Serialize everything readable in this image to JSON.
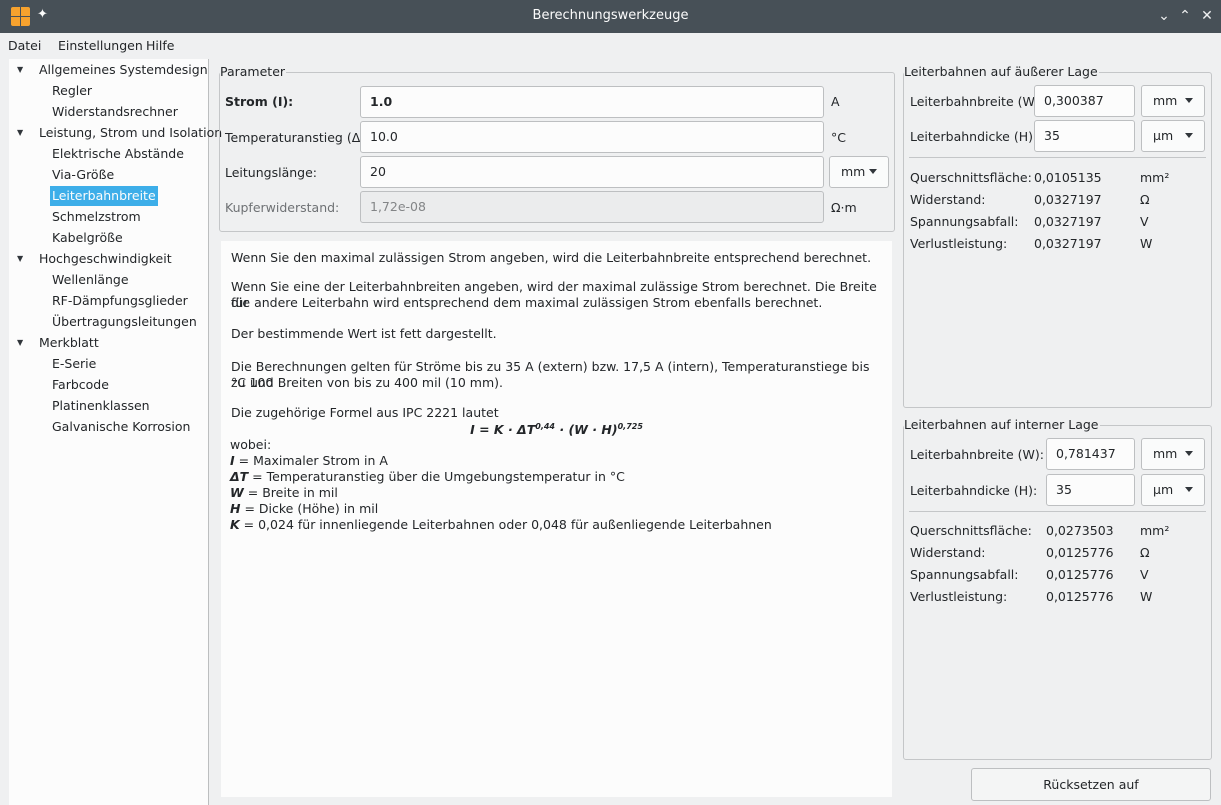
{
  "window": {
    "title": "Berechnungswerkzeuge",
    "controls": {
      "minimize": "⌄",
      "maximize": "⌃",
      "close": "✕"
    }
  },
  "menubar": [
    "Datei",
    "Einstellungen",
    "Hilfe"
  ],
  "sidebar": {
    "groups": [
      {
        "label": "Allgemeines Systemdesign",
        "items": [
          "Regler",
          "Widerstandsrechner"
        ]
      },
      {
        "label": "Leistung, Strom und Isolation",
        "items": [
          "Elektrische Abstände",
          "Via-Größe",
          "Leiterbahnbreite",
          "Schmelzstrom",
          "Kabelgröße"
        ]
      },
      {
        "label": "Hochgeschwindigkeit",
        "items": [
          "Wellenlänge",
          "RF-Dämpfungsglieder",
          "Übertragungsleitungen"
        ]
      },
      {
        "label": "Merkblatt",
        "items": [
          "E-Serie",
          "Farbcode",
          "Platinenklassen",
          "Galvanische Korrosion"
        ]
      }
    ],
    "selected": "Leiterbahnbreite"
  },
  "parameters": {
    "title": "Parameter",
    "current_label": "Strom (I):",
    "current_value": "1.0",
    "current_unit": "A",
    "temp_label": "Temperaturanstieg (ΔT):",
    "temp_value": "10.0",
    "temp_unit": "°C",
    "length_label": "Leitungslänge:",
    "length_value": "20",
    "length_unit": "mm",
    "resist_label": "Kupferwiderstand:",
    "resist_value": "1,72e-08",
    "resist_unit": "Ω·m"
  },
  "description": {
    "p1": "Wenn Sie den maximal zulässigen Strom angeben, wird die Leiterbahnbreite entsprechend berechnet.",
    "p2a": "Wenn Sie eine der Leiterbahnbreiten angeben, wird der maximal zulässige Strom berechnet. Die Breite für",
    "p2b": "die andere Leiterbahn wird entsprechend dem maximal zulässigen Strom ebenfalls berechnet.",
    "p3": "Der bestimmende Wert ist fett dargestellt.",
    "p4a": "Die Berechnungen gelten für Ströme bis zu 35 A (extern) bzw. 17,5 A (intern), Temperaturanstiege bis zu 100",
    "p4b": "°C und Breiten von bis zu 400 mil (10 mm).",
    "p5": "Die zugehörige Formel aus IPC 2221 lautet",
    "formula_main": "I = K · ΔT",
    "formula_exp1": "0,44",
    "formula_mid": " · (W · H)",
    "formula_exp2": "0,725",
    "wobei": "wobei:",
    "defs": [
      {
        "sym": "I",
        "text": " = Maximaler Strom in A"
      },
      {
        "sym": "ΔT",
        "text": " = Temperaturanstieg über die Umgebungstemperatur in °C"
      },
      {
        "sym": "W",
        "text": " = Breite in mil"
      },
      {
        "sym": "H",
        "text": " = Dicke (Höhe) in mil"
      },
      {
        "sym": "K",
        "text": " = 0,024 für innenliegende Leiterbahnen oder 0,048 für außenliegende Leiterbahnen"
      }
    ]
  },
  "external": {
    "title": "Leiterbahnen auf äußerer Lage",
    "width_label": "Leiterbahnbreite (W):",
    "width_value": "0,300387",
    "width_unit": "mm",
    "thick_label": "Leiterbahndicke (H):",
    "thick_value": "35",
    "thick_unit": "µm",
    "results": [
      {
        "label": "Querschnittsfläche:",
        "value": "0,0105135",
        "unit": "mm²"
      },
      {
        "label": "Widerstand:",
        "value": "0,0327197",
        "unit": "Ω"
      },
      {
        "label": "Spannungsabfall:",
        "value": "0,0327197",
        "unit": "V"
      },
      {
        "label": "Verlustleistung:",
        "value": "0,0327197",
        "unit": "W"
      }
    ]
  },
  "internal": {
    "title": "Leiterbahnen auf interner Lage",
    "width_label": "Leiterbahnbreite (W):",
    "width_value": "0,781437",
    "width_unit": "mm",
    "thick_label": "Leiterbahndicke (H):",
    "thick_value": "35",
    "thick_unit": "µm",
    "results": [
      {
        "label": "Querschnittsfläche:",
        "value": "0,0273503",
        "unit": "mm²"
      },
      {
        "label": "Widerstand:",
        "value": "0,0125776",
        "unit": "Ω"
      },
      {
        "label": "Spannungsabfall:",
        "value": "0,0125776",
        "unit": "V"
      },
      {
        "label": "Verlustleistung:",
        "value": "0,0125776",
        "unit": "W"
      }
    ]
  },
  "reset_button": "Rücksetzen auf Standardeinstellungen"
}
